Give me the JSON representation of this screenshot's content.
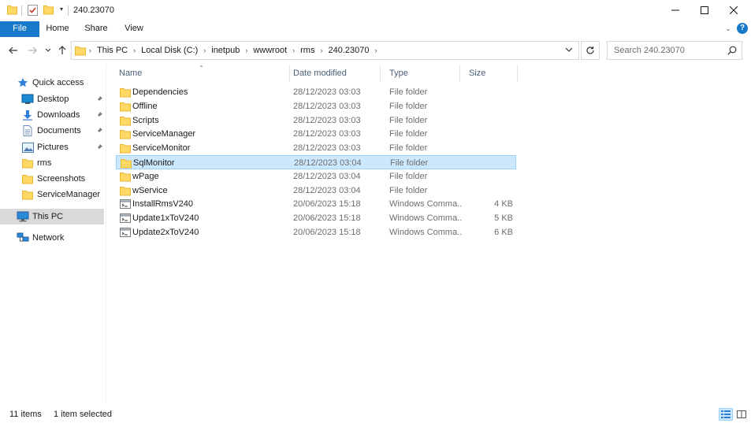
{
  "window": {
    "title": "240.23070",
    "minimize_icon": "minimize-icon",
    "maximize_icon": "maximize-icon",
    "close_icon": "close-icon"
  },
  "ribbon": {
    "tabs": [
      {
        "label": "File",
        "active": true
      },
      {
        "label": "Home"
      },
      {
        "label": "Share"
      },
      {
        "label": "View"
      }
    ],
    "help": "?"
  },
  "address": {
    "crumbs": [
      "This PC",
      "Local Disk (C:)",
      "inetpub",
      "wwwroot",
      "rms",
      "240.23070"
    ]
  },
  "search": {
    "placeholder": "Search 240.23070"
  },
  "sidebar": {
    "items": [
      {
        "label": "Quick access",
        "icon": "star-icon"
      },
      {
        "label": "Desktop",
        "icon": "desktop-icon",
        "pinned": true
      },
      {
        "label": "Downloads",
        "icon": "download-icon",
        "pinned": true
      },
      {
        "label": "Documents",
        "icon": "documents-icon",
        "pinned": true
      },
      {
        "label": "Pictures",
        "icon": "pictures-icon",
        "pinned": true
      },
      {
        "label": "rms",
        "icon": "folder-icon"
      },
      {
        "label": "Screenshots",
        "icon": "folder-icon"
      },
      {
        "label": "ServiceManager",
        "icon": "folder-icon"
      },
      {
        "label": "This PC",
        "icon": "computer-icon",
        "selected": true
      },
      {
        "label": "Network",
        "icon": "network-icon"
      }
    ]
  },
  "columns": {
    "name": "Name",
    "date": "Date modified",
    "type": "Type",
    "size": "Size"
  },
  "files": [
    {
      "name": "Dependencies",
      "date": "28/12/2023 03:03",
      "type": "File folder",
      "size": "",
      "kind": "folder"
    },
    {
      "name": "Offline",
      "date": "28/12/2023 03:03",
      "type": "File folder",
      "size": "",
      "kind": "folder"
    },
    {
      "name": "Scripts",
      "date": "28/12/2023 03:03",
      "type": "File folder",
      "size": "",
      "kind": "folder"
    },
    {
      "name": "ServiceManager",
      "date": "28/12/2023 03:03",
      "type": "File folder",
      "size": "",
      "kind": "folder"
    },
    {
      "name": "ServiceMonitor",
      "date": "28/12/2023 03:03",
      "type": "File folder",
      "size": "",
      "kind": "folder"
    },
    {
      "name": "SqlMonitor",
      "date": "28/12/2023 03:04",
      "type": "File folder",
      "size": "",
      "kind": "folder",
      "selected": true
    },
    {
      "name": "wPage",
      "date": "28/12/2023 03:04",
      "type": "File folder",
      "size": "",
      "kind": "folder"
    },
    {
      "name": "wService",
      "date": "28/12/2023 03:04",
      "type": "File folder",
      "size": "",
      "kind": "folder"
    },
    {
      "name": "InstallRmsV240",
      "date": "20/06/2023 15:18",
      "type": "Windows Comma...",
      "size": "4 KB",
      "kind": "script"
    },
    {
      "name": "Update1xToV240",
      "date": "20/06/2023 15:18",
      "type": "Windows Comma...",
      "size": "5 KB",
      "kind": "script"
    },
    {
      "name": "Update2xToV240",
      "date": "20/06/2023 15:18",
      "type": "Windows Comma...",
      "size": "6 KB",
      "kind": "script"
    }
  ],
  "status": {
    "item_count": "11 items",
    "selection": "1 item selected"
  },
  "colors": {
    "accent": "#1979ca",
    "folder": "#ffd866",
    "folder_dark": "#e8b730",
    "selection": "#cce8ff"
  }
}
